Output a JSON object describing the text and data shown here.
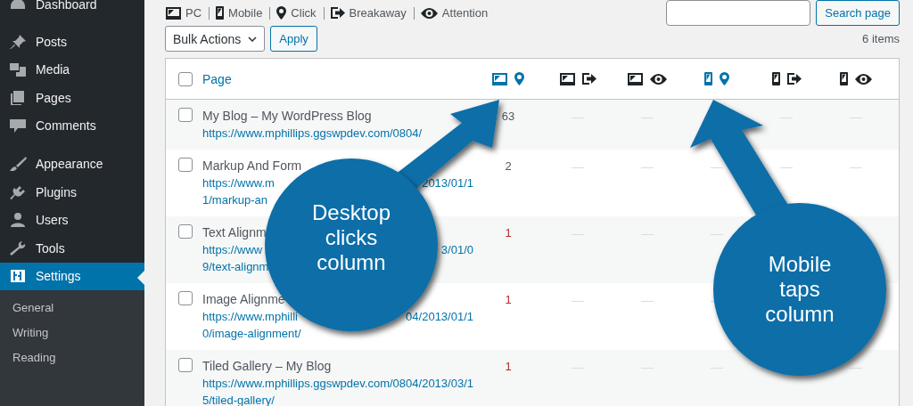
{
  "sidebar": {
    "items": [
      {
        "label": "Dashboard",
        "selected": false
      },
      {
        "label": "Posts",
        "selected": false
      },
      {
        "label": "Media",
        "selected": false
      },
      {
        "label": "Pages",
        "selected": false
      },
      {
        "label": "Comments",
        "selected": false
      },
      {
        "label": "Appearance",
        "selected": false
      },
      {
        "label": "Plugins",
        "selected": false
      },
      {
        "label": "Users",
        "selected": false
      },
      {
        "label": "Tools",
        "selected": false
      },
      {
        "label": "Settings",
        "selected": true
      }
    ],
    "submenu": [
      "General",
      "Writing",
      "Reading"
    ]
  },
  "legend": [
    {
      "label": "PC"
    },
    {
      "label": "Mobile"
    },
    {
      "label": "Click"
    },
    {
      "label": "Breakaway"
    },
    {
      "label": "Attention"
    }
  ],
  "search": {
    "button": "Search page"
  },
  "bulk_actions": {
    "value": "Bulk Actions",
    "apply": "Apply"
  },
  "item_count": "6 items",
  "table": {
    "page_heading": "Page",
    "select_all_checked": false,
    "columns": [
      {
        "active": true
      },
      {
        "active": false
      },
      {
        "active": false
      },
      {
        "active": true
      },
      {
        "active": false
      },
      {
        "active": false
      }
    ],
    "rows": [
      {
        "title": [
          "My Blog – My WordPress Blog"
        ],
        "url_lines": [
          [
            "https://www.mphillips.ggswpdev.com/0804/"
          ]
        ],
        "count": "63",
        "color": "#50575e",
        "checked": false
      },
      {
        "title": [
          "Markup And Form"
        ],
        "url_lines": [
          [
            "https://www.m",
            "2013/01/1"
          ],
          [
            "1/markup-an"
          ]
        ],
        "count": "2",
        "color": "#50575e",
        "checked": false
      },
      {
        "title": [
          "Text Alignm"
        ],
        "url_lines": [
          [
            "https://www",
            "3/01/0"
          ],
          [
            "9/text-alignm"
          ]
        ],
        "count": "1",
        "color": "#b32d2e",
        "checked": false
      },
      {
        "title": [
          "Image Alignme"
        ],
        "url_lines": [
          [
            "https://www.mphilli",
            "04/2013/01/1"
          ],
          [
            "0/image-alignment/"
          ]
        ],
        "count": "1",
        "color": "#b32d2e",
        "checked": false
      },
      {
        "title": [
          "Tiled Gallery – My Blog"
        ],
        "url_lines": [
          [
            "https://www.mphillips.ggswpdev.com/0804/2013/03/1"
          ],
          [
            "5/tiled-gallery/"
          ]
        ],
        "count": "1",
        "color": "#b32d2e",
        "checked": false
      }
    ]
  },
  "callouts": [
    {
      "lines": [
        "Desktop",
        "clicks",
        "column"
      ]
    },
    {
      "lines": [
        "Mobile",
        "taps",
        "column"
      ]
    }
  ]
}
